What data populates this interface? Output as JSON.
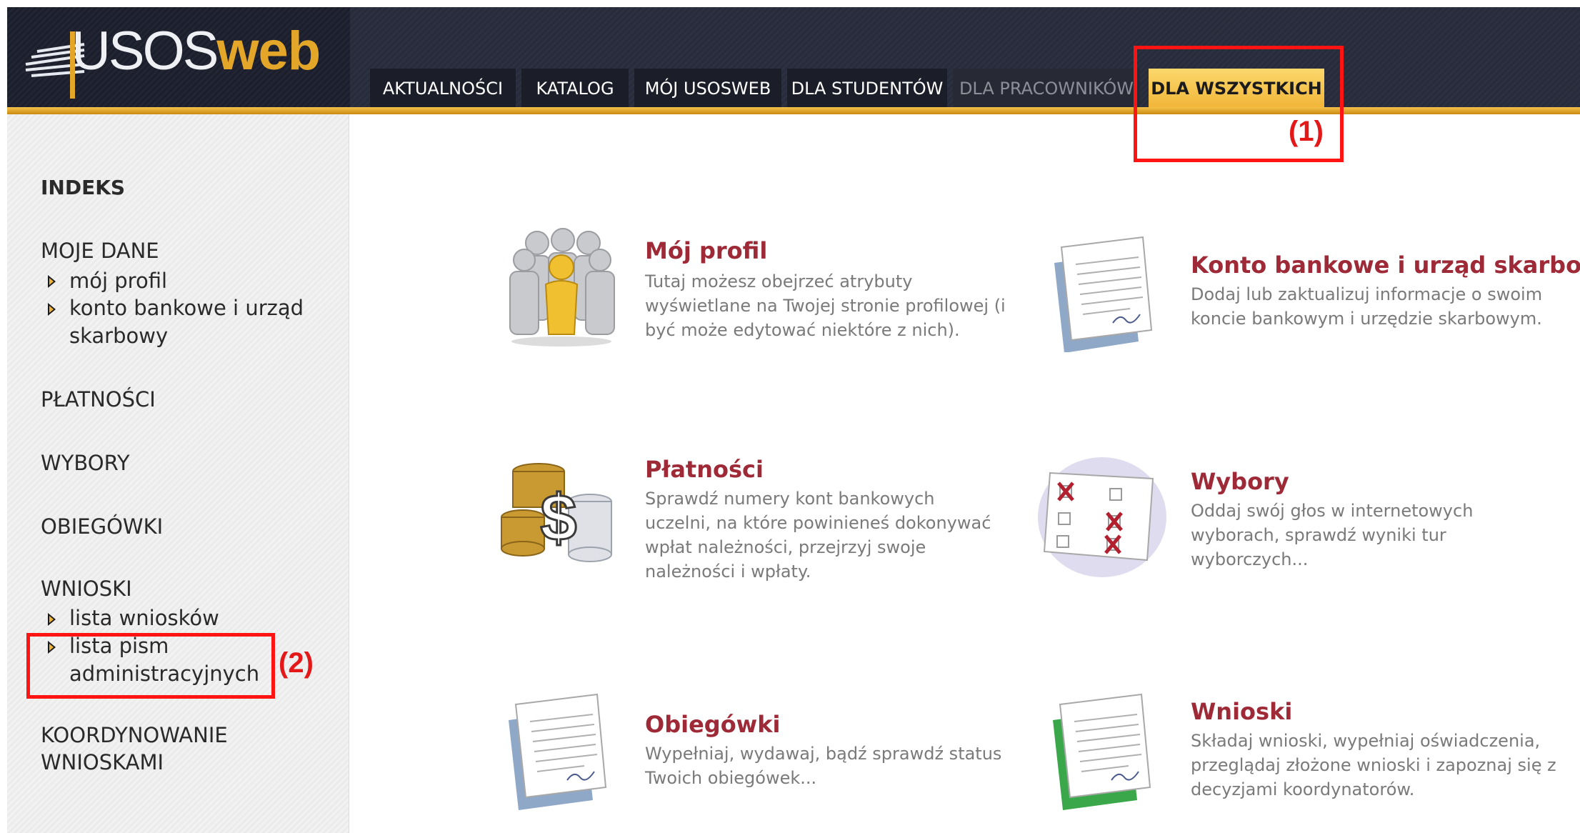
{
  "header": {
    "logo": {
      "usos": "USOS",
      "web": "web"
    },
    "tabs": [
      {
        "label": "AKTUALNOŚCI",
        "state": "normal"
      },
      {
        "label": "KATALOG",
        "state": "normal"
      },
      {
        "label": "MÓJ USOSWEB",
        "state": "normal"
      },
      {
        "label": "DLA STUDENTÓW",
        "state": "normal"
      },
      {
        "label": "DLA PRACOWNIKÓW",
        "state": "disabled"
      },
      {
        "label": "DLA WSZYSTKICH",
        "state": "active"
      }
    ]
  },
  "sidebar": {
    "heading": "INDEKS",
    "sections": [
      {
        "title": "MOJE DANE",
        "links": [
          "mój profil",
          "konto bankowe i urząd skarbowy"
        ]
      },
      {
        "title": "PŁATNOŚCI"
      },
      {
        "title": "WYBORY"
      },
      {
        "title": "OBIEGÓWKI"
      },
      {
        "title": "WNIOSKI",
        "links": [
          "lista wniosków",
          "lista pism administracyjnych"
        ]
      },
      {
        "title": "KOORDYNOWANIE WNIOSKAMI"
      }
    ]
  },
  "cards": [
    {
      "title": "Mój profil",
      "icon": "users-profile-icon",
      "description": "Tutaj możesz obejrzeć atrybuty wyświetlane na Twojej stronie profilowej (i być może edytować niektóre z nich)."
    },
    {
      "title": "Konto bankowe i urząd skarbowy",
      "icon": "bank-document-icon",
      "description": "Dodaj lub zaktualizuj informacje o swoim koncie bankowym i urzędzie skarbowym."
    },
    {
      "title": "Płatności",
      "icon": "coins-dollar-icon",
      "description": "Sprawdź numery kont bankowych uczelni, na które powinieneś dokonywać wpłat należności, przejrzyj swoje należności i wpłaty."
    },
    {
      "title": "Wybory",
      "icon": "ballot-icon",
      "description": "Oddaj swój głos w internetowych wyborach, sprawdź wyniki tur wyborczych..."
    },
    {
      "title": "Obiegówki",
      "icon": "document-icon",
      "description": "Wypełniaj, wydawaj, bądź sprawdź status Twoich obiegówek..."
    },
    {
      "title": "Wnioski",
      "icon": "application-document-icon",
      "description": "Składaj wnioski, wypełniaj oświadczenia, przeglądaj złożone wnioski i zapoznaj się z decyzjami koordynatorów."
    }
  ],
  "annotations": {
    "one": "(1)",
    "two": "(2)",
    "color": "#ff1414"
  },
  "colors": {
    "accent": "#f1b437",
    "card_title": "#9e2a37",
    "header_bg": "#2c3141"
  }
}
